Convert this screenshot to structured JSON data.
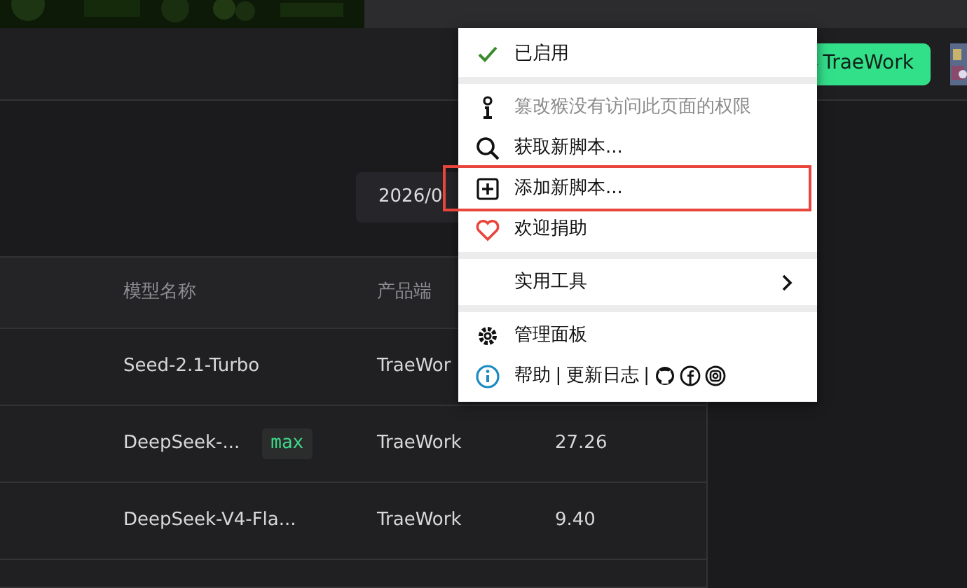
{
  "header": {
    "button": "TraeWork"
  },
  "filter": {
    "date": "2026/0"
  },
  "table": {
    "columns": [
      {
        "label": "模型名称"
      },
      {
        "label": "产品端"
      }
    ],
    "rows": [
      {
        "model": "Seed-2.1-Turbo",
        "product": "TraeWor"
      },
      {
        "model": "DeepSeek-...",
        "badge": "max",
        "product": "TraeWork",
        "value": "27.26"
      },
      {
        "model": "DeepSeek-V4-Fla...",
        "product": "TraeWork",
        "value": "9.40"
      }
    ]
  },
  "menu": {
    "sections": [
      {
        "items": [
          {
            "kind": "toggle",
            "label": "已启用",
            "checked": true,
            "disabled": false,
            "highlighted": false
          }
        ]
      },
      {
        "items": [
          {
            "kind": "action",
            "label": "篡改猴没有访问此页面的权限",
            "disabled": true,
            "highlighted": false
          },
          {
            "kind": "action",
            "label": "获取新脚本...",
            "disabled": false,
            "highlighted": false
          },
          {
            "kind": "action",
            "label": "添加新脚本...",
            "disabled": false,
            "highlighted": true
          },
          {
            "kind": "action",
            "label": "欢迎捐助",
            "disabled": false,
            "highlighted": false
          }
        ]
      },
      {
        "items": [
          {
            "kind": "submenu",
            "label": "实用工具",
            "disabled": false,
            "highlighted": false
          }
        ]
      },
      {
        "items": [
          {
            "kind": "action",
            "label": "管理面板",
            "disabled": false,
            "highlighted": false
          },
          {
            "kind": "links",
            "parts": [
              "帮助",
              "|",
              "更新日志",
              "|"
            ]
          }
        ]
      }
    ]
  }
}
